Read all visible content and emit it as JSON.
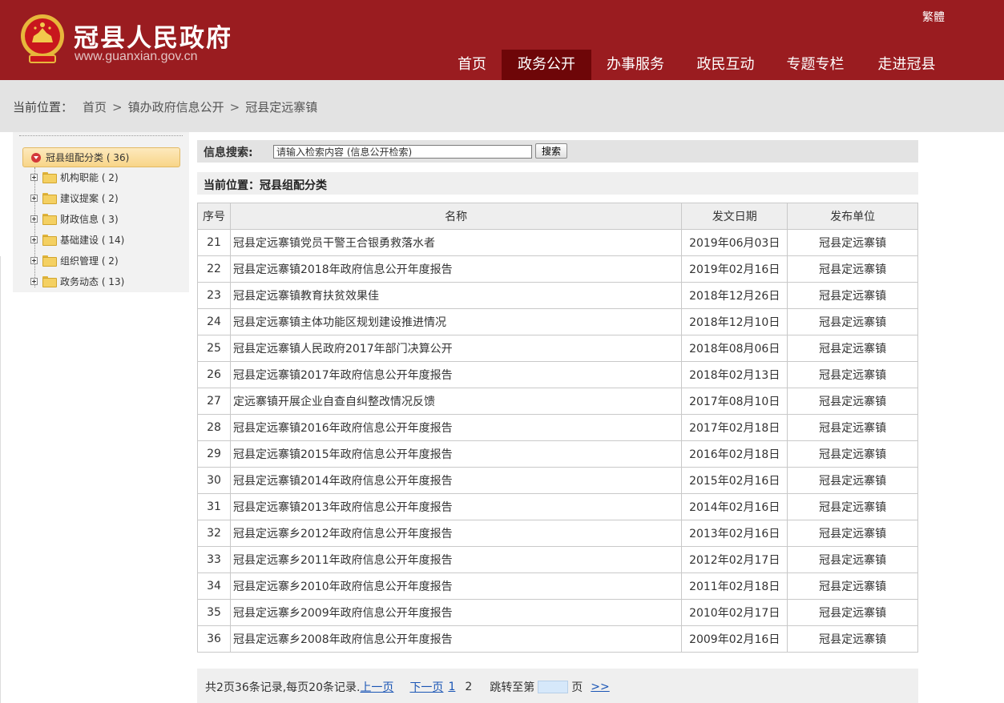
{
  "header": {
    "site_title": "冠县人民政府",
    "site_url": "www.guanxian.gov.cn",
    "lang_toggle": "繁體",
    "nav": [
      {
        "label": "首页",
        "active": false
      },
      {
        "label": "政务公开",
        "active": true
      },
      {
        "label": "办事服务",
        "active": false
      },
      {
        "label": "政民互动",
        "active": false
      },
      {
        "label": "专题专栏",
        "active": false
      },
      {
        "label": "走进冠县",
        "active": false
      }
    ]
  },
  "breadcrumb": {
    "prefix": "当前位置：",
    "items": [
      "首页",
      "镇办政府信息公开",
      "冠县定远寨镇"
    ],
    "separator": ">"
  },
  "sidebar": {
    "root_label": "冠县组配分类 ( 36)",
    "items": [
      {
        "label": "机构职能 ( 2)"
      },
      {
        "label": "建议提案 ( 2)"
      },
      {
        "label": "财政信息 ( 3)"
      },
      {
        "label": "基础建设 ( 14)"
      },
      {
        "label": "组织管理 ( 2)"
      },
      {
        "label": "政务动态 ( 13)"
      }
    ]
  },
  "search": {
    "label": "信息搜索:",
    "placeholder": "请输入检索内容 (信息公开检索)",
    "button_label": "搜索"
  },
  "location": {
    "label": "当前位置：冠县组配分类"
  },
  "table": {
    "headers": {
      "no": "序号",
      "name": "名称",
      "date": "发文日期",
      "unit": "发布单位"
    },
    "rows": [
      {
        "no": "21",
        "name": "冠县定远寨镇党员干警王合银勇救落水者",
        "date": "2019年06月03日",
        "unit": "冠县定远寨镇"
      },
      {
        "no": "22",
        "name": "冠县定远寨镇2018年政府信息公开年度报告",
        "date": "2019年02月16日",
        "unit": "冠县定远寨镇"
      },
      {
        "no": "23",
        "name": "冠县定远寨镇教育扶贫效果佳",
        "date": "2018年12月26日",
        "unit": "冠县定远寨镇"
      },
      {
        "no": "24",
        "name": "冠县定远寨镇主体功能区规划建设推进情况",
        "date": "2018年12月10日",
        "unit": "冠县定远寨镇"
      },
      {
        "no": "25",
        "name": "冠县定远寨镇人民政府2017年部门决算公开",
        "date": "2018年08月06日",
        "unit": "冠县定远寨镇"
      },
      {
        "no": "26",
        "name": "冠县定远寨镇2017年政府信息公开年度报告",
        "date": "2018年02月13日",
        "unit": "冠县定远寨镇"
      },
      {
        "no": "27",
        "name": "定远寨镇开展企业自查自纠整改情况反馈",
        "date": "2017年08月10日",
        "unit": "冠县定远寨镇"
      },
      {
        "no": "28",
        "name": "冠县定远寨镇2016年政府信息公开年度报告",
        "date": "2017年02月18日",
        "unit": "冠县定远寨镇"
      },
      {
        "no": "29",
        "name": "冠县定远寨镇2015年政府信息公开年度报告",
        "date": "2016年02月18日",
        "unit": "冠县定远寨镇"
      },
      {
        "no": "30",
        "name": "冠县定远寨镇2014年政府信息公开年度报告",
        "date": "2015年02月16日",
        "unit": "冠县定远寨镇"
      },
      {
        "no": "31",
        "name": "冠县定远寨镇2013年政府信息公开年度报告",
        "date": "2014年02月16日",
        "unit": "冠县定远寨镇"
      },
      {
        "no": "32",
        "name": "冠县定远寨乡2012年政府信息公开年度报告",
        "date": "2013年02月16日",
        "unit": "冠县定远寨镇"
      },
      {
        "no": "33",
        "name": "冠县定远寨乡2011年政府信息公开年度报告",
        "date": "2012年02月17日",
        "unit": "冠县定远寨镇"
      },
      {
        "no": "34",
        "name": "冠县定远寨乡2010年政府信息公开年度报告",
        "date": "2011年02月18日",
        "unit": "冠县定远寨镇"
      },
      {
        "no": "35",
        "name": "冠县定远寨乡2009年政府信息公开年度报告",
        "date": "2010年02月17日",
        "unit": "冠县定远寨镇"
      },
      {
        "no": "36",
        "name": "冠县定远寨乡2008年政府信息公开年度报告",
        "date": "2009年02月16日",
        "unit": "冠县定远寨镇"
      }
    ]
  },
  "pager": {
    "summary": "共2页36条记录,每页20条记录.",
    "prev_label": "上一页",
    "next_label": "下一页",
    "pages": [
      "1",
      "2"
    ],
    "current_page": "2",
    "jump_prefix": "跳转至第",
    "jump_suffix": "页",
    "go_label": ">>",
    "jump_value": ""
  },
  "colors": {
    "header_bg": "#9a1c20",
    "nav_active_bg": "#6e0608",
    "link": "#1a55b5"
  }
}
